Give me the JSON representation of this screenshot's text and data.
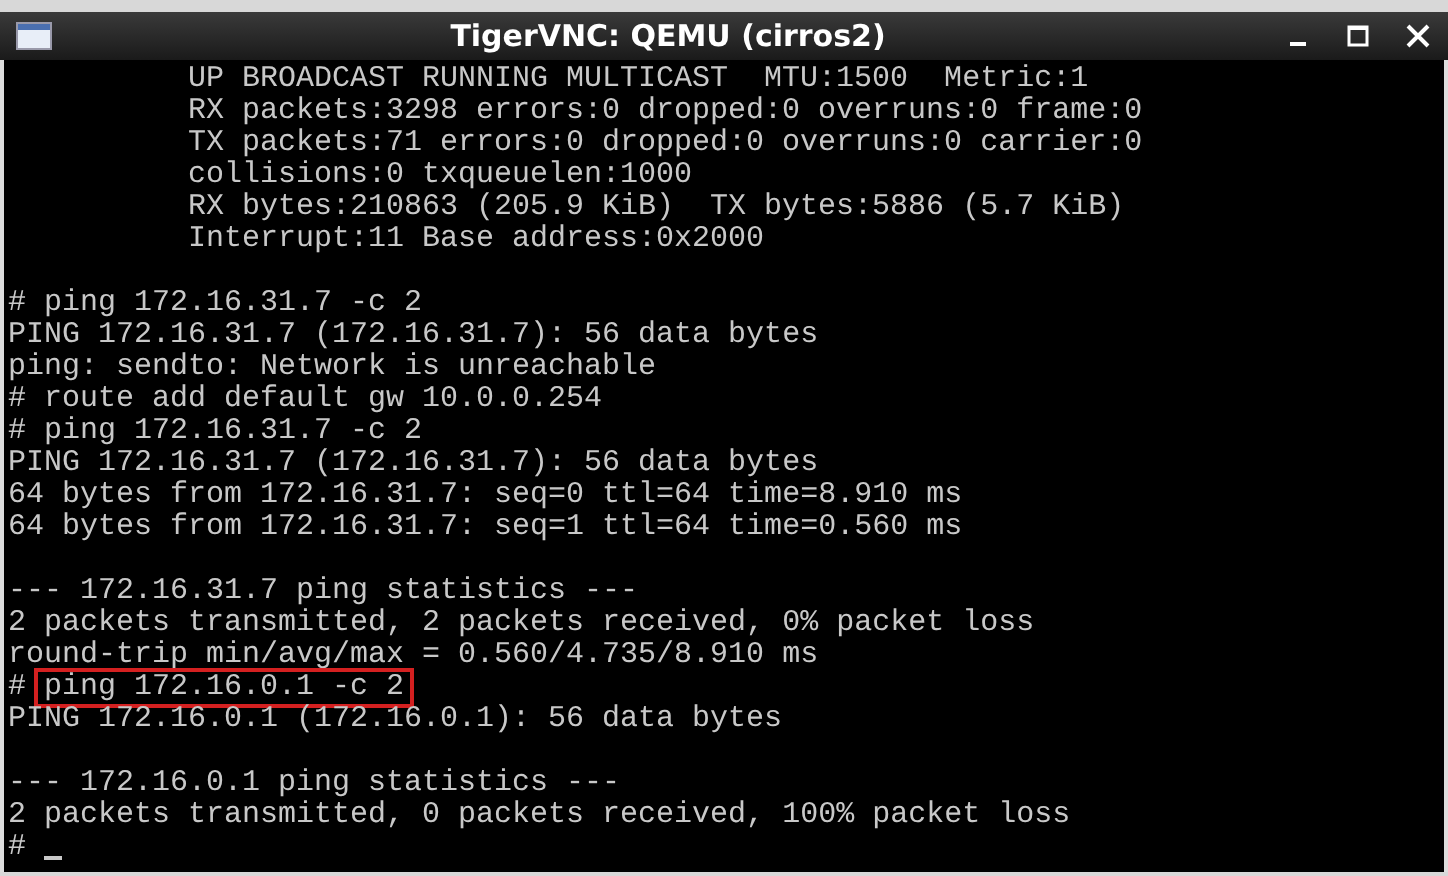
{
  "window": {
    "title": "TigerVNC: QEMU (cirros2)"
  },
  "terminal": {
    "lines": [
      {
        "kind": "detail",
        "text": "UP BROADCAST RUNNING MULTICAST  MTU:1500  Metric:1"
      },
      {
        "kind": "detail",
        "text": "RX packets:3298 errors:0 dropped:0 overruns:0 frame:0"
      },
      {
        "kind": "detail",
        "text": "TX packets:71 errors:0 dropped:0 overruns:0 carrier:0"
      },
      {
        "kind": "detail",
        "text": "collisions:0 txqueuelen:1000"
      },
      {
        "kind": "detail",
        "text": "RX bytes:210863 (205.9 KiB)  TX bytes:5886 (5.7 KiB)"
      },
      {
        "kind": "detail",
        "text": "Interrupt:11 Base address:0x2000"
      },
      {
        "kind": "blank"
      },
      {
        "kind": "command",
        "prompt": "#",
        "text": "ping 172.16.31.7 -c 2",
        "highlighted": false
      },
      {
        "kind": "output",
        "text": "PING 172.16.31.7 (172.16.31.7): 56 data bytes"
      },
      {
        "kind": "output",
        "text": "ping: sendto: Network is unreachable"
      },
      {
        "kind": "command",
        "prompt": "#",
        "text": "route add default gw 10.0.0.254",
        "highlighted": false
      },
      {
        "kind": "command",
        "prompt": "#",
        "text": "ping 172.16.31.7 -c 2",
        "highlighted": false
      },
      {
        "kind": "output",
        "text": "PING 172.16.31.7 (172.16.31.7): 56 data bytes"
      },
      {
        "kind": "output",
        "text": "64 bytes from 172.16.31.7: seq=0 ttl=64 time=8.910 ms"
      },
      {
        "kind": "output",
        "text": "64 bytes from 172.16.31.7: seq=1 ttl=64 time=0.560 ms"
      },
      {
        "kind": "blank"
      },
      {
        "kind": "output",
        "text": "--- 172.16.31.7 ping statistics ---"
      },
      {
        "kind": "output",
        "text": "2 packets transmitted, 2 packets received, 0% packet loss"
      },
      {
        "kind": "output",
        "text": "round-trip min/avg/max = 0.560/4.735/8.910 ms"
      },
      {
        "kind": "command",
        "prompt": "#",
        "text": "ping 172.16.0.1 -c 2",
        "highlighted": true
      },
      {
        "kind": "output",
        "text": "PING 172.16.0.1 (172.16.0.1): 56 data bytes"
      },
      {
        "kind": "blank"
      },
      {
        "kind": "output",
        "text": "--- 172.16.0.1 ping statistics ---"
      },
      {
        "kind": "output",
        "text": "2 packets transmitted, 0 packets received, 100% packet loss"
      },
      {
        "kind": "cursor",
        "prompt": "#"
      }
    ]
  }
}
